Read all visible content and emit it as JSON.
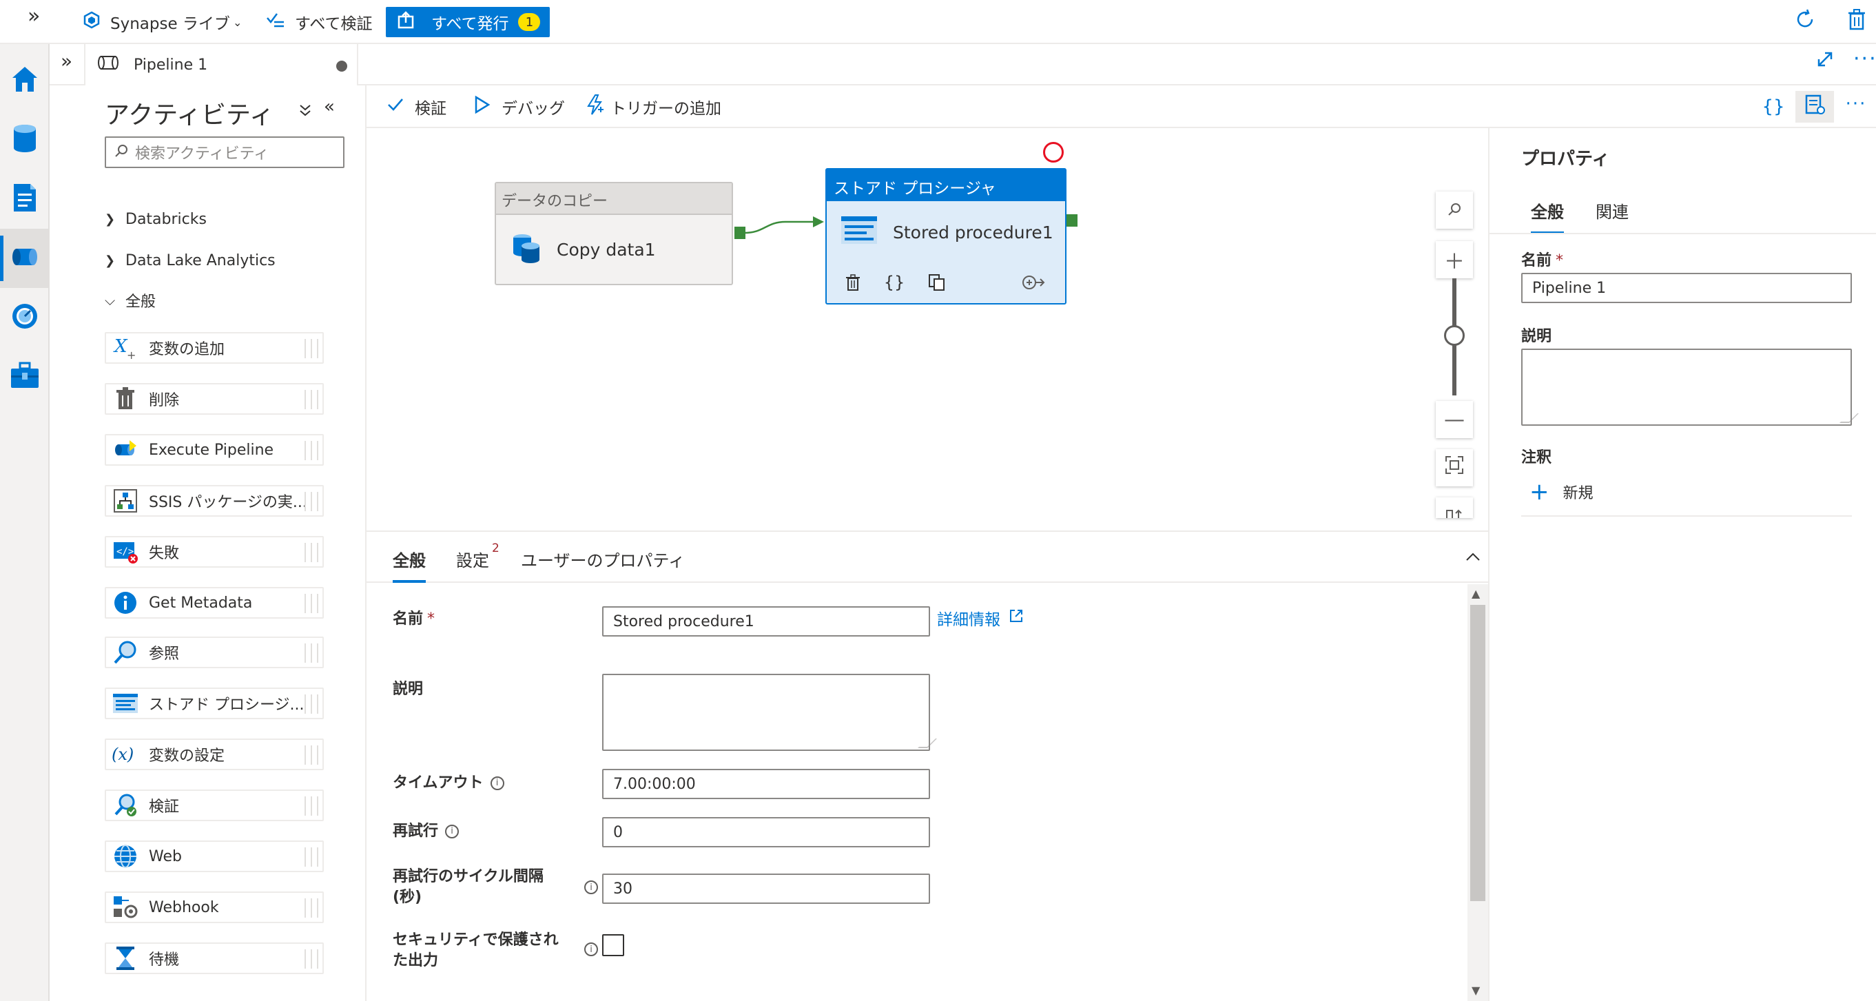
{
  "topbar": {
    "expand_label": "»",
    "live_mode_label": "Synapse ライブ",
    "validate_all_label": "すべて検証",
    "publish_all_label": "すべて発行",
    "publish_badge": "1",
    "icons": [
      "synapse-live-icon",
      "validate-all-icon",
      "publish-icon",
      "refresh-icon",
      "discard-icon"
    ]
  },
  "nav": {
    "items": [
      "home",
      "data",
      "develop",
      "integrate",
      "monitor",
      "manage"
    ],
    "active": "integrate"
  },
  "tabbar": {
    "collapse_label": "»",
    "pipeline_tab_label": "Pipeline 1",
    "unsaved": true
  },
  "activities": {
    "title": "アクティビティ",
    "collapse_all_label": "⌄⌄",
    "hide_label": "«",
    "search_placeholder": "検索アクティビティ",
    "groups": [
      {
        "label": "Databricks",
        "expanded": false
      },
      {
        "label": "Data Lake Analytics",
        "expanded": false
      },
      {
        "label": "全般",
        "expanded": true
      }
    ],
    "items": [
      {
        "label": "変数の追加",
        "icon": "append-variable-icon"
      },
      {
        "label": "削除",
        "icon": "delete-activity-icon"
      },
      {
        "label": "Execute Pipeline",
        "icon": "execute-pipeline-icon"
      },
      {
        "label": "SSIS パッケージの実...",
        "icon": "ssis-package-icon"
      },
      {
        "label": "失敗",
        "icon": "fail-icon"
      },
      {
        "label": "Get Metadata",
        "icon": "get-metadata-icon"
      },
      {
        "label": "参照",
        "icon": "lookup-icon"
      },
      {
        "label": "ストアド プロシージ...",
        "icon": "stored-procedure-icon"
      },
      {
        "label": "変数の設定",
        "icon": "set-variable-icon"
      },
      {
        "label": "検証",
        "icon": "validation-icon"
      },
      {
        "label": "Web",
        "icon": "web-icon"
      },
      {
        "label": "Webhook",
        "icon": "webhook-icon"
      },
      {
        "label": "待機",
        "icon": "wait-icon"
      }
    ]
  },
  "pipeline_toolbar": {
    "validate_label": "検証",
    "debug_label": "デバッグ",
    "add_trigger_label": "トリガーの追加",
    "code_label": "{}",
    "more_label": "···"
  },
  "canvas": {
    "copy_node": {
      "header": "データのコピー",
      "name": "Copy data1"
    },
    "sp_node": {
      "header": "ストアド プロシージャ",
      "name": "Stored procedure1",
      "action_code": "{}"
    }
  },
  "bottom_panel": {
    "tabs": [
      {
        "label": "全般",
        "active": true
      },
      {
        "label": "設定",
        "badge": "2"
      },
      {
        "label": "ユーザーのプロパティ"
      }
    ],
    "fields": {
      "name_label": "名前",
      "name_value": "Stored procedure1",
      "required_mark": "*",
      "learn_more": "詳細情報",
      "description_label": "説明",
      "timeout_label": "タイムアウト",
      "timeout_value": "7.00:00:00",
      "retry_label": "再試行",
      "retry_value": "0",
      "retry_interval_label_1": "再試行のサイクル間隔",
      "retry_interval_label_2": "(秒)",
      "retry_interval_value": "30",
      "secure_output_label_1": "セキュリティで保護され",
      "secure_output_label_2": "た出力",
      "secure_output_checked": false,
      "info_glyph": "i"
    }
  },
  "properties": {
    "title": "プロパティ",
    "tabs": [
      {
        "label": "全般",
        "active": true
      },
      {
        "label": "関連"
      }
    ],
    "name_label": "名前",
    "required_mark": "*",
    "name_value": "Pipeline 1",
    "description_label": "説明",
    "annotations_label": "注釈",
    "new_label": "新規",
    "new_glyph": "+"
  },
  "colors": {
    "accent": "#0078d4",
    "selected_node_fill": "#deecf9",
    "success_port": "#3b8c3b",
    "error_ring": "#e81123",
    "badge": "#fce100"
  }
}
